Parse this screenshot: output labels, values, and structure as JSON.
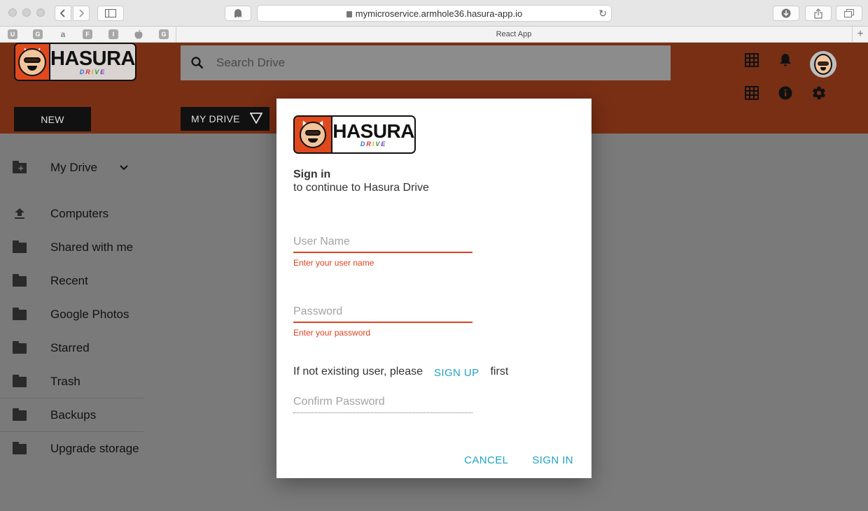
{
  "browser": {
    "url": "mymicroservice.armhole36.hasura-app.io",
    "tab_title": "React App",
    "favorites": [
      "U",
      "G",
      "a",
      "F",
      "I",
      "",
      "G"
    ]
  },
  "header": {
    "logo_text": "HASURA",
    "logo_subtext": [
      "D",
      "R",
      "I",
      "V",
      "E"
    ],
    "search_placeholder": "Search Drive",
    "new_label": "NEW",
    "my_drive_label": "MY DRIVE"
  },
  "sidebar": {
    "items": [
      {
        "label": "My Drive",
        "icon": "folder-add-icon"
      },
      {
        "label": "Computers",
        "icon": "upload-icon"
      },
      {
        "label": "Shared with me",
        "icon": "folder-icon"
      },
      {
        "label": "Recent",
        "icon": "folder-icon"
      },
      {
        "label": "Google Photos",
        "icon": "folder-icon"
      },
      {
        "label": "Starred",
        "icon": "folder-icon"
      },
      {
        "label": "Trash",
        "icon": "folder-icon"
      },
      {
        "label": "Backups",
        "icon": "folder-icon"
      },
      {
        "label": "Upgrade storage",
        "icon": "folder-icon"
      }
    ]
  },
  "dialog": {
    "title": "Sign in",
    "subtitle": "to continue to Hasura Drive",
    "username": {
      "placeholder": "User Name",
      "value": "",
      "error": "Enter your user name"
    },
    "password": {
      "placeholder": "Password",
      "value": "",
      "error": "Enter your password"
    },
    "signup_prefix": "If not existing user, please",
    "signup_label": "SIGN UP",
    "signup_suffix": "first",
    "confirm_password": {
      "placeholder": "Confirm Password",
      "value": ""
    },
    "cancel_label": "CANCEL",
    "signin_label": "SIGN IN"
  },
  "colors": {
    "header_bg": "#792f14",
    "accent": "#1fa3c4",
    "error": "#e0401f",
    "logo_orange": "#e0491d"
  }
}
